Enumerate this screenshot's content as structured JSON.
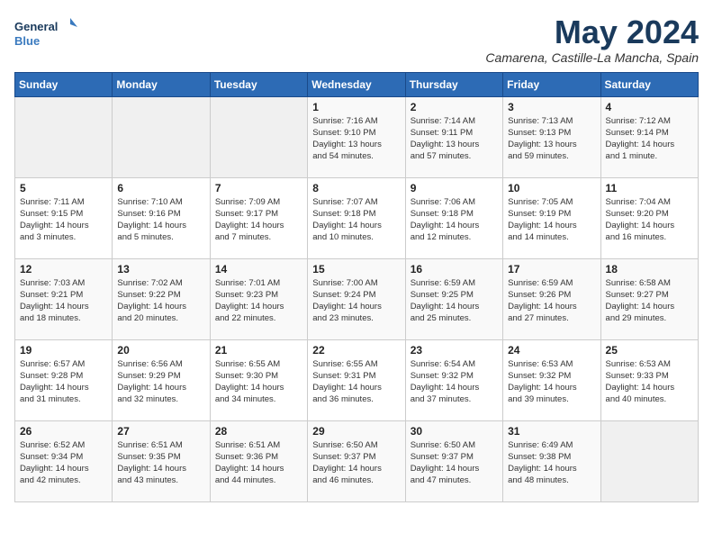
{
  "logo": {
    "line1": "General",
    "line2": "Blue"
  },
  "title": "May 2024",
  "subtitle": "Camarena, Castille-La Mancha, Spain",
  "days_of_week": [
    "Sunday",
    "Monday",
    "Tuesday",
    "Wednesday",
    "Thursday",
    "Friday",
    "Saturday"
  ],
  "weeks": [
    [
      {
        "day": "",
        "info": ""
      },
      {
        "day": "",
        "info": ""
      },
      {
        "day": "",
        "info": ""
      },
      {
        "day": "1",
        "info": "Sunrise: 7:16 AM\nSunset: 9:10 PM\nDaylight: 13 hours\nand 54 minutes."
      },
      {
        "day": "2",
        "info": "Sunrise: 7:14 AM\nSunset: 9:11 PM\nDaylight: 13 hours\nand 57 minutes."
      },
      {
        "day": "3",
        "info": "Sunrise: 7:13 AM\nSunset: 9:13 PM\nDaylight: 13 hours\nand 59 minutes."
      },
      {
        "day": "4",
        "info": "Sunrise: 7:12 AM\nSunset: 9:14 PM\nDaylight: 14 hours\nand 1 minute."
      }
    ],
    [
      {
        "day": "5",
        "info": "Sunrise: 7:11 AM\nSunset: 9:15 PM\nDaylight: 14 hours\nand 3 minutes."
      },
      {
        "day": "6",
        "info": "Sunrise: 7:10 AM\nSunset: 9:16 PM\nDaylight: 14 hours\nand 5 minutes."
      },
      {
        "day": "7",
        "info": "Sunrise: 7:09 AM\nSunset: 9:17 PM\nDaylight: 14 hours\nand 7 minutes."
      },
      {
        "day": "8",
        "info": "Sunrise: 7:07 AM\nSunset: 9:18 PM\nDaylight: 14 hours\nand 10 minutes."
      },
      {
        "day": "9",
        "info": "Sunrise: 7:06 AM\nSunset: 9:18 PM\nDaylight: 14 hours\nand 12 minutes."
      },
      {
        "day": "10",
        "info": "Sunrise: 7:05 AM\nSunset: 9:19 PM\nDaylight: 14 hours\nand 14 minutes."
      },
      {
        "day": "11",
        "info": "Sunrise: 7:04 AM\nSunset: 9:20 PM\nDaylight: 14 hours\nand 16 minutes."
      }
    ],
    [
      {
        "day": "12",
        "info": "Sunrise: 7:03 AM\nSunset: 9:21 PM\nDaylight: 14 hours\nand 18 minutes."
      },
      {
        "day": "13",
        "info": "Sunrise: 7:02 AM\nSunset: 9:22 PM\nDaylight: 14 hours\nand 20 minutes."
      },
      {
        "day": "14",
        "info": "Sunrise: 7:01 AM\nSunset: 9:23 PM\nDaylight: 14 hours\nand 22 minutes."
      },
      {
        "day": "15",
        "info": "Sunrise: 7:00 AM\nSunset: 9:24 PM\nDaylight: 14 hours\nand 23 minutes."
      },
      {
        "day": "16",
        "info": "Sunrise: 6:59 AM\nSunset: 9:25 PM\nDaylight: 14 hours\nand 25 minutes."
      },
      {
        "day": "17",
        "info": "Sunrise: 6:59 AM\nSunset: 9:26 PM\nDaylight: 14 hours\nand 27 minutes."
      },
      {
        "day": "18",
        "info": "Sunrise: 6:58 AM\nSunset: 9:27 PM\nDaylight: 14 hours\nand 29 minutes."
      }
    ],
    [
      {
        "day": "19",
        "info": "Sunrise: 6:57 AM\nSunset: 9:28 PM\nDaylight: 14 hours\nand 31 minutes."
      },
      {
        "day": "20",
        "info": "Sunrise: 6:56 AM\nSunset: 9:29 PM\nDaylight: 14 hours\nand 32 minutes."
      },
      {
        "day": "21",
        "info": "Sunrise: 6:55 AM\nSunset: 9:30 PM\nDaylight: 14 hours\nand 34 minutes."
      },
      {
        "day": "22",
        "info": "Sunrise: 6:55 AM\nSunset: 9:31 PM\nDaylight: 14 hours\nand 36 minutes."
      },
      {
        "day": "23",
        "info": "Sunrise: 6:54 AM\nSunset: 9:32 PM\nDaylight: 14 hours\nand 37 minutes."
      },
      {
        "day": "24",
        "info": "Sunrise: 6:53 AM\nSunset: 9:32 PM\nDaylight: 14 hours\nand 39 minutes."
      },
      {
        "day": "25",
        "info": "Sunrise: 6:53 AM\nSunset: 9:33 PM\nDaylight: 14 hours\nand 40 minutes."
      }
    ],
    [
      {
        "day": "26",
        "info": "Sunrise: 6:52 AM\nSunset: 9:34 PM\nDaylight: 14 hours\nand 42 minutes."
      },
      {
        "day": "27",
        "info": "Sunrise: 6:51 AM\nSunset: 9:35 PM\nDaylight: 14 hours\nand 43 minutes."
      },
      {
        "day": "28",
        "info": "Sunrise: 6:51 AM\nSunset: 9:36 PM\nDaylight: 14 hours\nand 44 minutes."
      },
      {
        "day": "29",
        "info": "Sunrise: 6:50 AM\nSunset: 9:37 PM\nDaylight: 14 hours\nand 46 minutes."
      },
      {
        "day": "30",
        "info": "Sunrise: 6:50 AM\nSunset: 9:37 PM\nDaylight: 14 hours\nand 47 minutes."
      },
      {
        "day": "31",
        "info": "Sunrise: 6:49 AM\nSunset: 9:38 PM\nDaylight: 14 hours\nand 48 minutes."
      },
      {
        "day": "",
        "info": ""
      }
    ]
  ]
}
